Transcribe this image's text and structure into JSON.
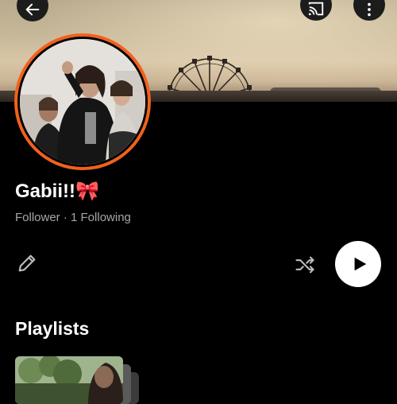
{
  "header": {
    "back_icon": "arrow-left-icon",
    "cast_icon": "cast-icon",
    "more_icon": "more-vertical-icon"
  },
  "profile": {
    "name": "Gabii!!",
    "name_emoji": "🎀",
    "follow_stats": "Follower · 1 Following",
    "ring_color": "#f0611e"
  },
  "actions": {
    "edit_icon": "pencil-icon",
    "shuffle_icon": "shuffle-icon",
    "play_icon": "play-icon"
  },
  "sections": {
    "playlists_title": "Playlists"
  }
}
